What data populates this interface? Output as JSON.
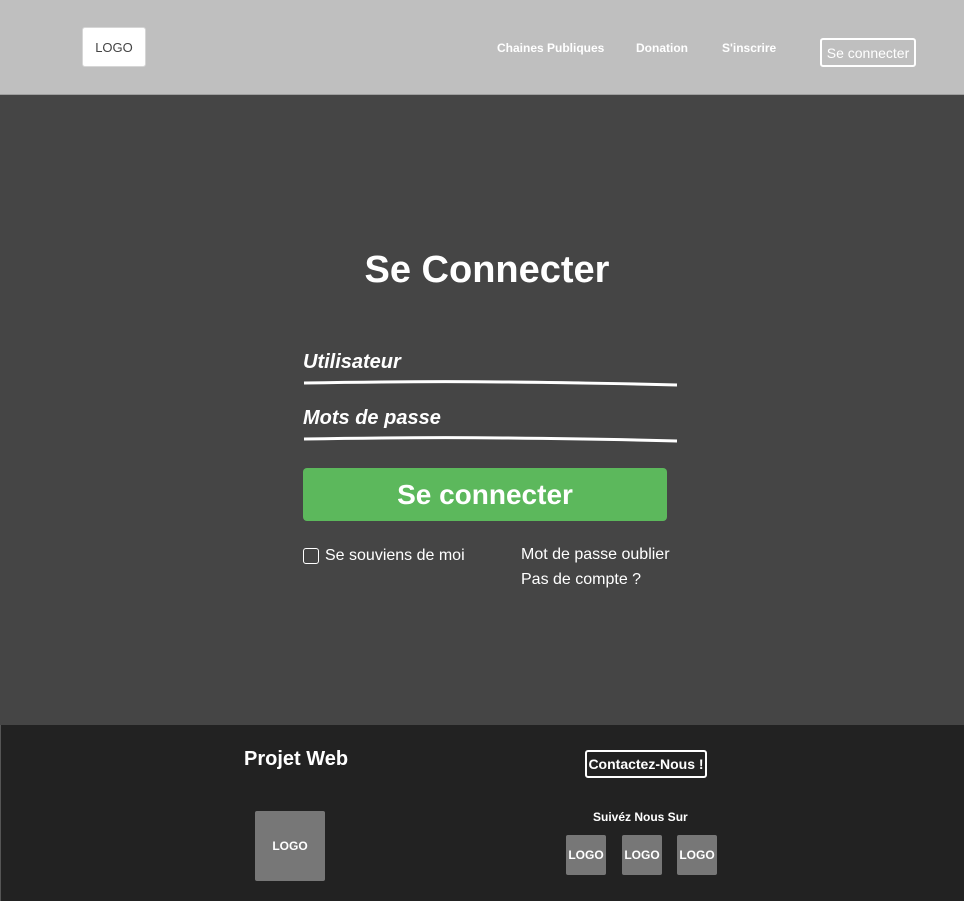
{
  "header": {
    "logo_text": "LOGO",
    "nav": {
      "chaines": "Chaines Publiques",
      "donation": "Donation",
      "inscrire": "S'inscrire",
      "login": "Se connecter"
    }
  },
  "login_form": {
    "title": "Se Connecter",
    "username_label": "Utilisateur",
    "password_label": "Mots de passe",
    "submit_label": "Se connecter",
    "remember_label": "Se souviens de moi",
    "remember_checked": false,
    "forgot_link": "Mot de passe oublier",
    "no_account_link": "Pas de compte ?"
  },
  "footer": {
    "title": "Projet Web",
    "logo_text": "LOGO",
    "contact_label": "Contactez-Nous !",
    "follow_label": "Suivéz Nous Sur",
    "social_logos": [
      "LOGO",
      "LOGO",
      "LOGO"
    ]
  },
  "colors": {
    "header_bg": "#bfbfbf",
    "main_bg": "#454545",
    "footer_bg": "#222222",
    "submit_green": "#5cb85c",
    "placeholder_logo_bg": "#777777"
  }
}
